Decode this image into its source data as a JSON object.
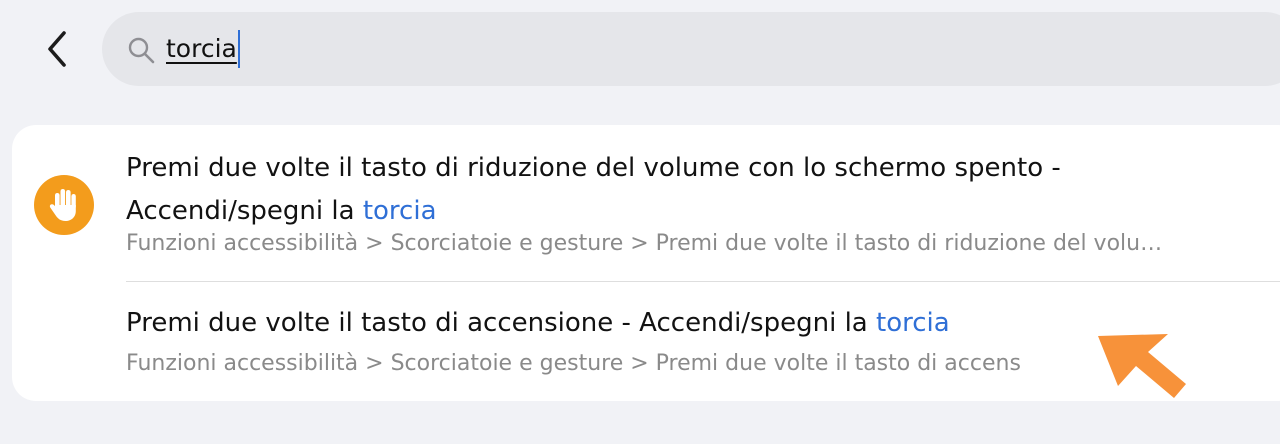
{
  "header": {
    "back_icon": "chevron-left-icon",
    "search": {
      "icon": "search-icon",
      "value": "torcia"
    }
  },
  "results": [
    {
      "icon": "hand-icon",
      "icon_color": "#f39c1c",
      "title_prefix": "Premi due volte il tasto di riduzione del volume con lo schermo spento - Accendi/spegni la ",
      "title_highlight": "torcia",
      "path": "Funzioni accessibilità > Scorciatoie e gesture > Premi due volte il tasto di riduzione del volu",
      "path_ellipsis": "…"
    },
    {
      "title_prefix": "Premi due volte il tasto di accensione - Accendi/spegni la ",
      "title_highlight": "torcia",
      "path": "Funzioni accessibilità > Scorciatoie e gesture > Premi due volte il tasto di accens"
    }
  ],
  "colors": {
    "accent": "#2f6fd6",
    "pointer_arrow": "#f7923a"
  }
}
